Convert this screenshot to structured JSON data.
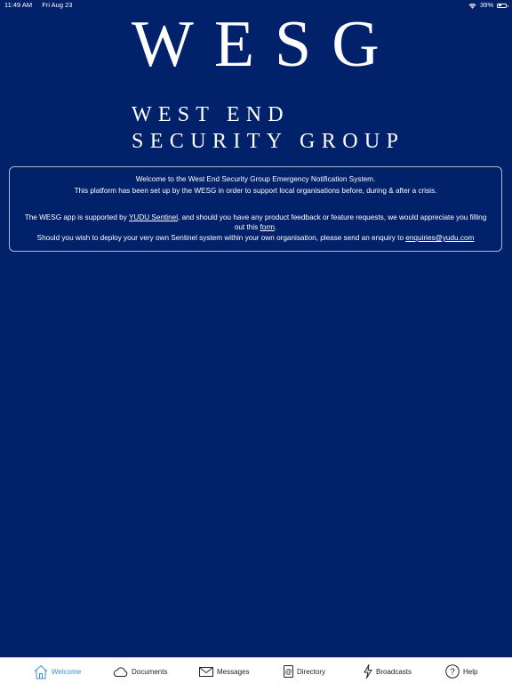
{
  "status_bar": {
    "time": "11:49 AM",
    "date": "Fri Aug 23",
    "battery_percent": "39%",
    "battery_level": 0.39,
    "wifi_icon": "wifi-icon",
    "battery_icon": "battery-icon"
  },
  "logo": {
    "acronym": "WESG",
    "line1": "WEST END",
    "line2": "SECURITY GROUP"
  },
  "welcome": {
    "line1": "Welcome to the West End Security Group Emergency Notification System.",
    "line2": "This platform has been set up by the WESG in order to support local organisations before, during & after a crisis.",
    "line3_before": "The WESG app is supported by ",
    "line3_link": "YUDU Sentinel",
    "line3_middle": ", and should you have any product feedback or feature requests, we would appreciate you filling out this ",
    "line3_form_link": "form",
    "line3_end": ".",
    "line4_before": "Should you wish to deploy your very own Sentinel system within your own organisation, please send an enquiry to ",
    "line4_email": "enquiries@yudu.com"
  },
  "tabs": [
    {
      "label": "Welcome",
      "icon": "house-icon",
      "active": true
    },
    {
      "label": "Documents",
      "icon": "cloud-icon",
      "active": false
    },
    {
      "label": "Messages",
      "icon": "envelope-icon",
      "active": false
    },
    {
      "label": "Directory",
      "icon": "address-book-icon",
      "active": false
    },
    {
      "label": "Broadcasts",
      "icon": "lightning-icon",
      "active": false
    },
    {
      "label": "Help",
      "icon": "question-circle-icon",
      "active": false
    }
  ],
  "colors": {
    "background": "#01216a",
    "tab_active": "#3b8fd9",
    "tab_inactive": "#222222"
  }
}
